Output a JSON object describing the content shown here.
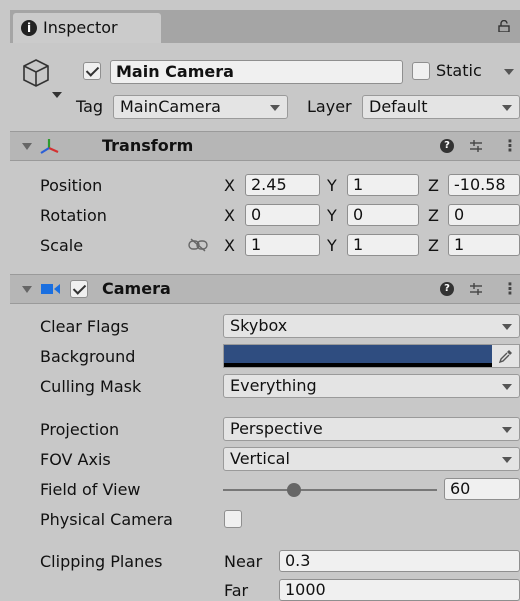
{
  "tab": {
    "label": "Inspector"
  },
  "object": {
    "active": true,
    "name": "Main Camera",
    "static_label": "Static",
    "static_checked": false,
    "tag_label": "Tag",
    "tag_value": "MainCamera",
    "layer_label": "Layer",
    "layer_value": "Default"
  },
  "transform": {
    "title": "Transform",
    "rows": [
      {
        "label": "Position",
        "x": "2.45",
        "y": "1",
        "z": "-10.58"
      },
      {
        "label": "Rotation",
        "x": "0",
        "y": "0",
        "z": "0"
      },
      {
        "label": "Scale",
        "x": "1",
        "y": "1",
        "z": "1"
      }
    ],
    "axis": {
      "x": "X",
      "y": "Y",
      "z": "Z"
    }
  },
  "camera": {
    "title": "Camera",
    "enabled": true,
    "clear_flags_label": "Clear Flags",
    "clear_flags_value": "Skybox",
    "background_label": "Background",
    "background_color": "#2f4d80",
    "culling_mask_label": "Culling Mask",
    "culling_mask_value": "Everything",
    "projection_label": "Projection",
    "projection_value": "Perspective",
    "fov_axis_label": "FOV Axis",
    "fov_axis_value": "Vertical",
    "fov_label": "Field of View",
    "fov_value": "60",
    "fov_fraction": 0.33,
    "physical_camera_label": "Physical Camera",
    "physical_camera_checked": false,
    "clipping_label": "Clipping Planes",
    "near_label": "Near",
    "near_value": "0.3",
    "far_label": "Far",
    "far_value": "1000"
  },
  "colors": {
    "panel": "#c8c8c8",
    "header": "#b6b6b6",
    "tabbar": "#a5a5a5",
    "camera_icon": "#1a6fe0"
  }
}
